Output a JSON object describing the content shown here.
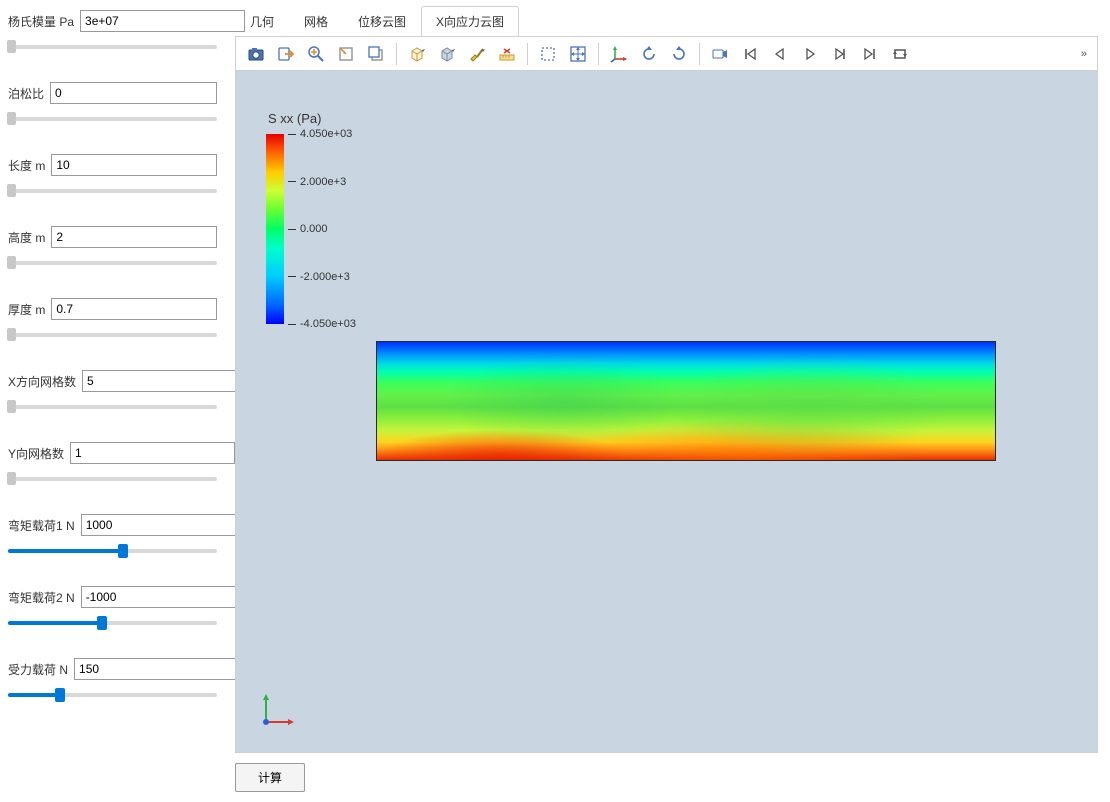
{
  "sidebar": {
    "params": [
      {
        "label": "杨氏模量 Pa",
        "value": "3e+07",
        "thumb_pct": 2,
        "fill_pct": 0,
        "grey": true
      },
      {
        "label": "泊松比",
        "value": "0",
        "thumb_pct": 2,
        "fill_pct": 0,
        "grey": true
      },
      {
        "label": "长度 m",
        "value": "10",
        "thumb_pct": 2,
        "fill_pct": 0,
        "grey": true
      },
      {
        "label": "高度 m",
        "value": "2",
        "thumb_pct": 2,
        "fill_pct": 0,
        "grey": true
      },
      {
        "label": "厚度 m",
        "value": "0.7",
        "thumb_pct": 2,
        "fill_pct": 0,
        "grey": true
      },
      {
        "label": "X方向网格数",
        "value": "5",
        "thumb_pct": 2,
        "fill_pct": 0,
        "grey": true
      },
      {
        "label": "Y向网格数",
        "value": "1",
        "thumb_pct": 2,
        "fill_pct": 0,
        "grey": true
      },
      {
        "label": "弯矩载荷1 N",
        "value": "1000",
        "thumb_pct": 55,
        "fill_pct": 55,
        "grey": false
      },
      {
        "label": "弯矩载荷2 N",
        "value": "-1000",
        "thumb_pct": 45,
        "fill_pct": 45,
        "grey": false
      },
      {
        "label": "受力载荷 N",
        "value": "150",
        "thumb_pct": 25,
        "fill_pct": 25,
        "grey": false
      }
    ]
  },
  "tabs": [
    {
      "label": "几何",
      "active": false
    },
    {
      "label": "网格",
      "active": false
    },
    {
      "label": "位移云图",
      "active": false
    },
    {
      "label": "X向应力云图",
      "active": true
    }
  ],
  "toolbar_icons": [
    "camera-icon",
    "export-icon",
    "zoom-icon",
    "select-box-icon",
    "select-front-icon",
    "sep",
    "cube-outline-icon",
    "cube-solid-icon",
    "brush-icon",
    "ruler-icon",
    "sep",
    "dashed-select-icon",
    "fit-extents-icon",
    "sep",
    "axes-icon",
    "rotate-ccw-icon",
    "rotate-cw-icon",
    "sep",
    "record-icon",
    "skip-first-icon",
    "step-back-icon",
    "play-icon",
    "step-forward-icon",
    "skip-last-icon",
    "loop-icon"
  ],
  "toolbar_overflow": "»",
  "legend": {
    "title": "S xx (Pa)",
    "ticks": [
      {
        "pct": 0,
        "label": "4.050e+03"
      },
      {
        "pct": 25,
        "label": "2.000e+3"
      },
      {
        "pct": 50,
        "label": "0.000"
      },
      {
        "pct": 75,
        "label": "-2.000e+3"
      },
      {
        "pct": 100,
        "label": "-4.050e+03"
      }
    ]
  },
  "compute_label": "计算",
  "chart_data": {
    "type": "heatmap",
    "title": "X向应力云图",
    "variable": "S xx",
    "unit": "Pa",
    "color_range": [
      -4050,
      4050
    ],
    "color_ticks": [
      4050,
      2000,
      0,
      -2000,
      -4050
    ],
    "domain": {
      "length_m": 10,
      "height_m": 2
    },
    "description": "Rectangular beam stress contour: tension (red, ~+4050 Pa) along bottom edge grading through green (~0 Pa) near mid-height to compression (blue, ~-4050 Pa) at top-left corner; right side predominantly green (near zero)."
  }
}
